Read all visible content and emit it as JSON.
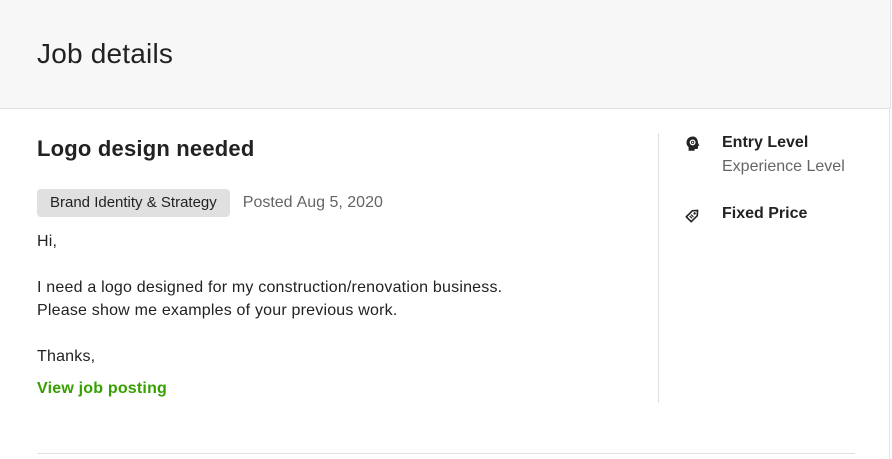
{
  "header": {
    "title": "Job details"
  },
  "job": {
    "title": "Logo design needed",
    "category": "Brand Identity & Strategy",
    "posted_label": "Posted",
    "posted_date": "Aug 5, 2020",
    "description": {
      "greeting": "Hi,",
      "line1": "I need a logo designed for my construction/renovation business.",
      "line2": "Please show me examples of your previous work.",
      "closing": "Thanks,"
    },
    "view_link_label": "View job posting"
  },
  "sidebar": {
    "experience": {
      "icon": "experience-level-icon",
      "value": "Entry Level",
      "label": "Experience Level"
    },
    "budget": {
      "icon": "price-tag-icon",
      "value": "Fixed Price"
    }
  },
  "colors": {
    "link": "#37a000",
    "header_bg": "#f7f7f7",
    "badge_bg": "#e0e0e0",
    "muted_text": "#656565"
  }
}
